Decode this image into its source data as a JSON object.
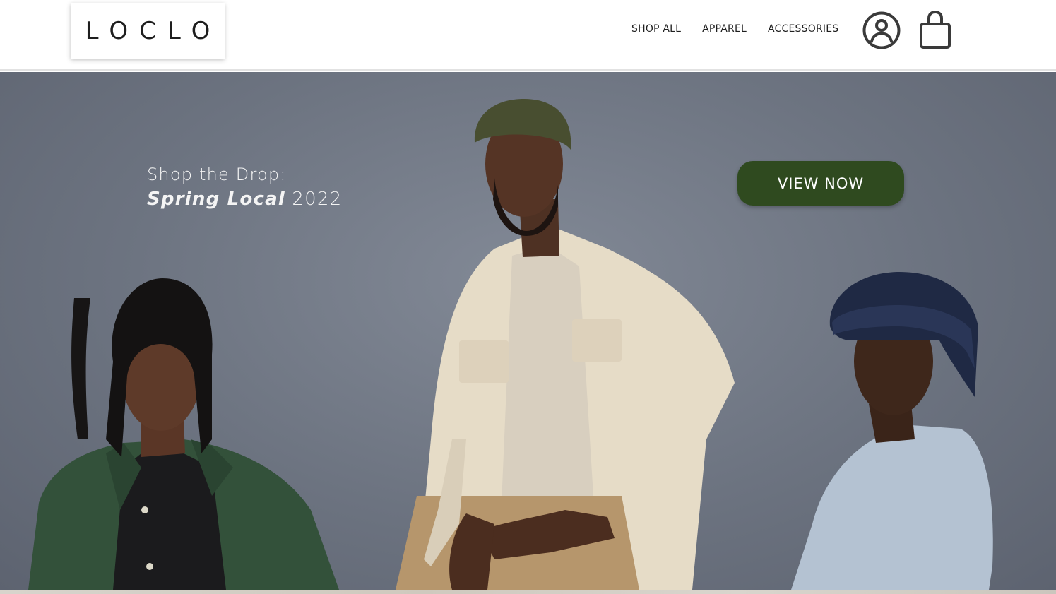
{
  "brand": {
    "logo_text": "LOCLO"
  },
  "nav": {
    "items": [
      {
        "label": "SHOP ALL"
      },
      {
        "label": "APPAREL"
      },
      {
        "label": "ACCESSORIES"
      }
    ],
    "account_icon": "user-circle-icon",
    "cart_icon": "shopping-bag-icon"
  },
  "hero": {
    "line1": "Shop the Drop:",
    "line2_italic": "Spring Local",
    "line2_year": "2022",
    "cta_label": "VIEW NOW",
    "image": "three-models-photo"
  },
  "colors": {
    "cta_background": "#2f4a1f",
    "hero_background": "#6c7380",
    "text_dark": "#1e1e1e"
  }
}
